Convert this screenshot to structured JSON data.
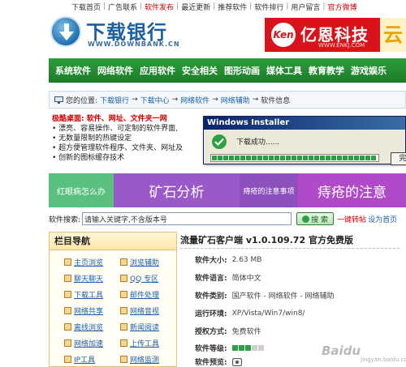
{
  "top_links": [
    "下载首页",
    "广告联系",
    "软件发布",
    "最近更新",
    "推荐软件",
    "软件排行",
    "用户留言",
    "官方微博"
  ],
  "header": {
    "logo_title": "下载银行",
    "logo_sub": "WWW.DOWNBANK.CN",
    "ad_badge": "Ken",
    "ad_name": "亿恩科技",
    "ad_url": "WWW.ENKJ.COM",
    "ad_right": "云"
  },
  "nav": [
    "系统软件",
    "网络软件",
    "应用软件",
    "安全相关",
    "图形动画",
    "媒体工具",
    "教育教学",
    "游戏娱乐"
  ],
  "breadcrumb": {
    "prefix": "您的位置:",
    "items": [
      "下载银行",
      "下载中心",
      "网络软件",
      "网络辅助"
    ],
    "current": "软件信息"
  },
  "features": {
    "title": "极酷桌面: 软件、网址、文件夹一网",
    "items": [
      "漂亮、容易操作、可定制的软件界面,",
      "无数量限制的热键设定",
      "超方便管理软件程序、文件夹、网址及",
      "创新的图标缓存技术"
    ]
  },
  "dialog": {
    "title": "Windows Installer",
    "message": "下载成功......",
    "button": "完",
    "progress_blocks": 29
  },
  "banner": [
    "红眼病怎么办",
    "矿石分析",
    "痔疮的注意事项",
    "痔疮的注意"
  ],
  "search": {
    "label": "软件搜索:",
    "placeholder": "请输入关键字,不含版本号",
    "button": "搜 索",
    "link_red": "一键转帖",
    "link_blue": "设为首页"
  },
  "sidebar": {
    "title": "栏目导航",
    "items": [
      "主页浏览",
      "浏览辅助",
      "聊天聊天",
      "QQ 专区",
      "下载工具",
      "邮件处理",
      "网络共享",
      "网络音视",
      "离线浏览",
      "新闻阅读",
      "网络加速",
      "上传工具",
      "IP工具",
      "网络监测"
    ]
  },
  "software": {
    "title": "流量矿石客户端 v1.0.109.72 官方免费版",
    "rows": [
      {
        "key": "软件大小:",
        "value": "2.63 MB"
      },
      {
        "key": "软件语言:",
        "value": "简体中文"
      },
      {
        "key": "软件类别:",
        "value": "国产软件 - 网络软件 - 网络辅助"
      },
      {
        "key": "运行环境:",
        "value": "XP/Vista/Win7/win8/"
      },
      {
        "key": "授权方式:",
        "value": "免费软件"
      },
      {
        "key": "软件等级:",
        "value": ""
      },
      {
        "key": "软件预览:",
        "value": ""
      }
    ],
    "rating": 3,
    "rating_max": 5
  },
  "watermark": {
    "text": "Baidu",
    "sub": "jingyan.baidu.com"
  },
  "colors": {
    "nav_green": "#1c7c29",
    "brand_blue": "#1b5f9e",
    "ad_red": "#d9131b",
    "dialog_blue": "#0a246a"
  }
}
